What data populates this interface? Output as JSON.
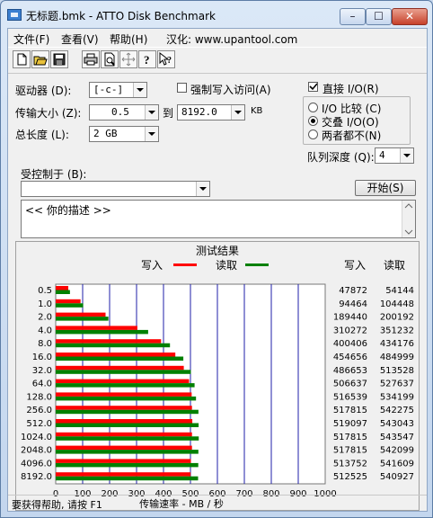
{
  "window": {
    "title": "无标题.bmk - ATTO Disk Benchmark",
    "buttons": [
      "–",
      "☐",
      "✕"
    ]
  },
  "menu": [
    {
      "label": "文件(F)"
    },
    {
      "label": "查看(V)"
    },
    {
      "label": "帮助(H)"
    },
    {
      "label": "汉化: www.upantool.com"
    }
  ],
  "toolbar": {
    "icons": [
      "new-icon",
      "open-icon",
      "save-icon",
      "print-icon",
      "print-preview-icon",
      "move-icon",
      "help-icon",
      "context-help-icon"
    ]
  },
  "settings": {
    "drive_label": "驱动器 (D):",
    "drive_value": "[-c-]",
    "force_write_label": "强制写入访问(A)",
    "force_write_checked": false,
    "transfer_size_label": "传输大小 (Z):",
    "transfer_from": "0.5",
    "to_label": "到",
    "transfer_to": "8192.0",
    "kb_label": "KB",
    "total_length_label": "总长度 (L):",
    "total_length_value": "2 GB",
    "direct_io_label": "直接 I/O(R)",
    "direct_io_checked": true,
    "io_options": [
      {
        "label": "I/O 比较 (C)",
        "selected": false
      },
      {
        "label": "交叠 I/O(O)",
        "selected": true
      },
      {
        "label": "两者都不(N)",
        "selected": false
      }
    ],
    "queue_depth_label": "队列深度 (Q):",
    "queue_depth_value": "4",
    "controlled_by_label": "受控制于 (B):",
    "controlled_by_value": "",
    "start_button": "开始(S)",
    "description": "<<   你的描述   >>"
  },
  "results": {
    "title": "测试结果",
    "legend_write": "写入",
    "legend_read": "读取",
    "col_write": "写入",
    "col_read": "读取",
    "write_color": "#ff0000",
    "read_color": "#008000"
  },
  "chart_data": {
    "type": "bar",
    "orientation": "horizontal",
    "title": "测试结果",
    "xlabel": "传输速率 - MB / 秒",
    "xlim": [
      0,
      1000
    ],
    "xticks": [
      0,
      100,
      200,
      300,
      400,
      500,
      600,
      700,
      800,
      900,
      1000
    ],
    "grid": true,
    "legend_position": "top",
    "categories": [
      "0.5",
      "1.0",
      "2.0",
      "4.0",
      "8.0",
      "16.0",
      "32.0",
      "64.0",
      "128.0",
      "256.0",
      "512.0",
      "1024.0",
      "2048.0",
      "4096.0",
      "8192.0"
    ],
    "series": [
      {
        "name": "写入",
        "color": "#ff0000",
        "values": [
          46.7,
          92.2,
          185.0,
          303.0,
          391.0,
          443.9,
          475.3,
          494.8,
          504.5,
          505.7,
          506.9,
          505.7,
          505.7,
          501.7,
          500.5
        ]
      },
      {
        "name": "读取",
        "color": "#008000",
        "values": [
          52.9,
          102.0,
          195.5,
          343.0,
          424.0,
          473.6,
          501.5,
          515.3,
          520.6,
          529.6,
          530.3,
          530.8,
          529.4,
          529.0,
          528.3
        ]
      }
    ],
    "table": {
      "write": [
        "47872",
        "94464",
        "189440",
        "310272",
        "400406",
        "454656",
        "486653",
        "506637",
        "516539",
        "517815",
        "519097",
        "517815",
        "517815",
        "513752",
        "512525"
      ],
      "read": [
        "54144",
        "104448",
        "200192",
        "351232",
        "434176",
        "484999",
        "513528",
        "527637",
        "534199",
        "542275",
        "543043",
        "543547",
        "542099",
        "541609",
        "540927"
      ]
    }
  },
  "status": {
    "text": "要获得帮助, 请按 F1"
  }
}
